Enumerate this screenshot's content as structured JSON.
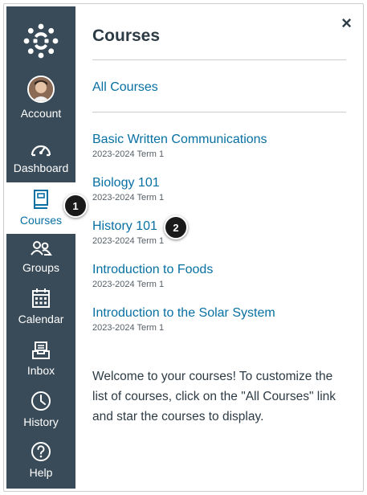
{
  "nav": {
    "items": [
      {
        "label": "Account"
      },
      {
        "label": "Dashboard"
      },
      {
        "label": "Courses"
      },
      {
        "label": "Groups"
      },
      {
        "label": "Calendar"
      },
      {
        "label": "Inbox"
      },
      {
        "label": "History"
      },
      {
        "label": "Help"
      }
    ]
  },
  "tray": {
    "title": "Courses",
    "close_label": "×",
    "all_courses_label": "All Courses",
    "courses": [
      {
        "name": "Basic Written Communications",
        "term": "2023-2024 Term 1"
      },
      {
        "name": "Biology 101",
        "term": "2023-2024 Term 1"
      },
      {
        "name": "History 101",
        "term": "2023-2024 Term 1"
      },
      {
        "name": "Introduction to Foods",
        "term": "2023-2024 Term 1"
      },
      {
        "name": "Introduction to the Solar System",
        "term": "2023-2024 Term 1"
      }
    ],
    "welcome_text": "Welcome to your courses! To customize the list of courses, click on the \"All Courses\" link and star the courses to display."
  },
  "callouts": [
    "1",
    "2"
  ],
  "colors": {
    "nav_bg": "#394b58",
    "link": "#0770a3",
    "text": "#2d3b45"
  }
}
